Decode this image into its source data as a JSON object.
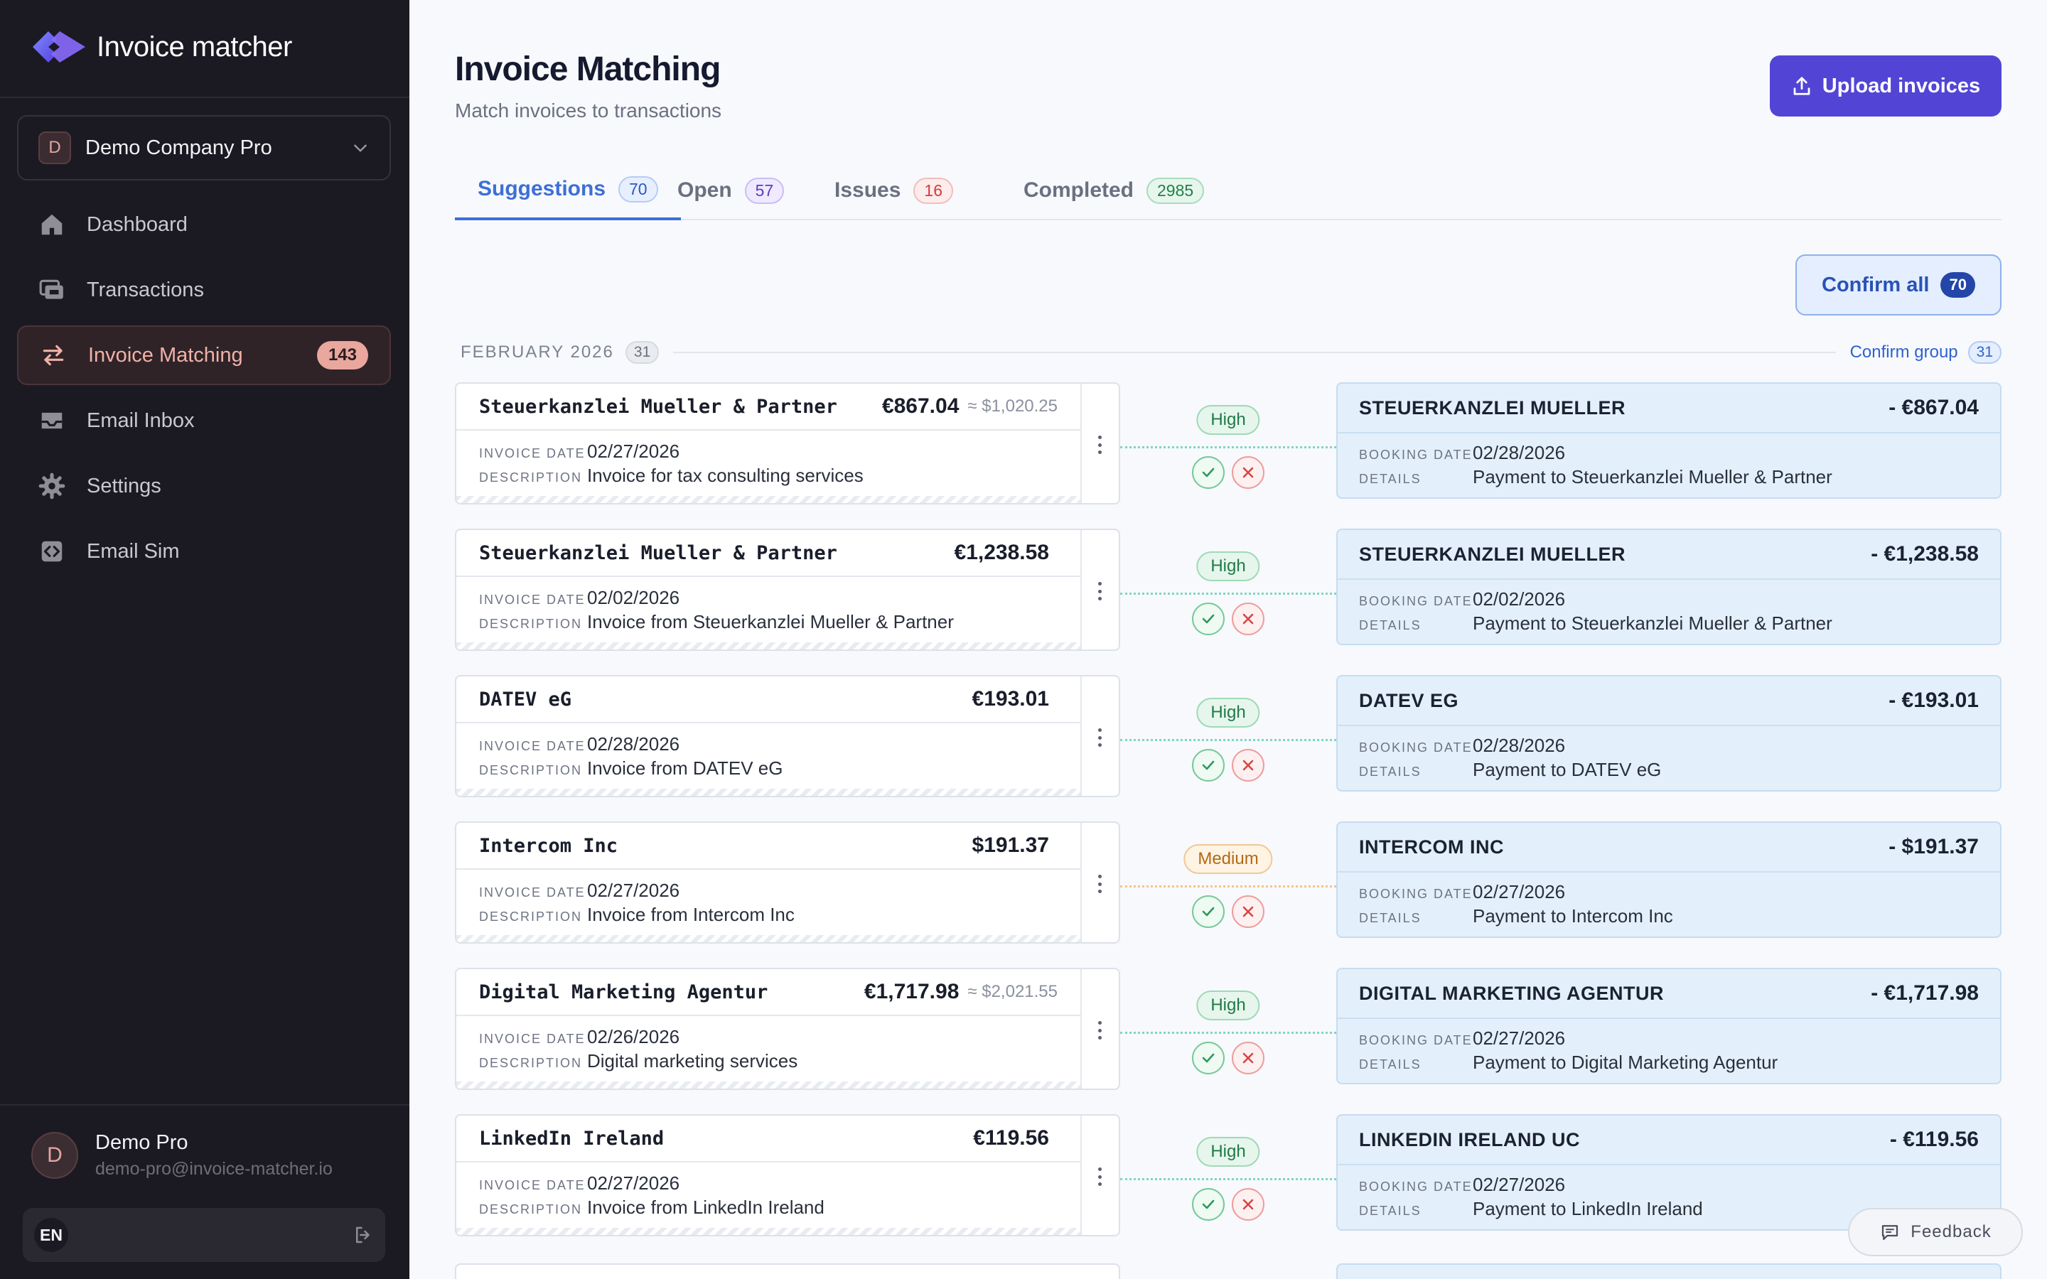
{
  "app": {
    "name": "Invoice matcher"
  },
  "company": {
    "initial": "D",
    "name": "Demo Company Pro"
  },
  "nav": [
    {
      "label": "Dashboard",
      "icon": "home-icon",
      "badge": ""
    },
    {
      "label": "Transactions",
      "icon": "transactions-icon",
      "badge": ""
    },
    {
      "label": "Invoice Matching",
      "icon": "swap-arrows-icon",
      "badge": "143"
    },
    {
      "label": "Email Inbox",
      "icon": "inbox-icon",
      "badge": ""
    },
    {
      "label": "Settings",
      "icon": "gear-icon",
      "badge": ""
    },
    {
      "label": "Email Sim",
      "icon": "code-icon",
      "badge": ""
    }
  ],
  "user": {
    "initial": "D",
    "name": "Demo Pro",
    "email": "demo-pro@invoice-matcher.io",
    "lang": "EN"
  },
  "header": {
    "title": "Invoice Matching",
    "subtitle": "Match invoices to transactions",
    "upload_label": "Upload invoices"
  },
  "tabs": [
    {
      "label": "Suggestions",
      "count": "70"
    },
    {
      "label": "Open",
      "count": "57"
    },
    {
      "label": "Issues",
      "count": "16"
    },
    {
      "label": "Completed",
      "count": "2985"
    }
  ],
  "confirm_all": {
    "label": "Confirm all",
    "count": "70"
  },
  "group": {
    "label": "FEBRUARY 2026",
    "count": "31",
    "confirm_label": "Confirm group",
    "confirm_count": "31"
  },
  "labels": {
    "invoice_date": "INVOICE DATE",
    "description": "DESCRIPTION",
    "booking_date": "BOOKING DATE",
    "details": "DETAILS"
  },
  "rows": [
    {
      "vendor": "Steuerkanzlei Mueller & Partner",
      "amount": "€867.04",
      "converted": "≈ $1,020.25",
      "invoice_date": "02/27/2026",
      "description": "Invoice for tax consulting services",
      "confidence": "High",
      "txn_name": "STEUERKANZLEI MUELLER",
      "txn_amount": "- €867.04",
      "booking_date": "02/28/2026",
      "details": "Payment to Steuerkanzlei Mueller & Partner"
    },
    {
      "vendor": "Steuerkanzlei Mueller & Partner",
      "amount": "€1,238.58",
      "converted": "",
      "invoice_date": "02/02/2026",
      "description": "Invoice from Steuerkanzlei Mueller & Partner",
      "confidence": "High",
      "txn_name": "STEUERKANZLEI MUELLER",
      "txn_amount": "- €1,238.58",
      "booking_date": "02/02/2026",
      "details": "Payment to Steuerkanzlei Mueller & Partner"
    },
    {
      "vendor": "DATEV eG",
      "amount": "€193.01",
      "converted": "",
      "invoice_date": "02/28/2026",
      "description": "Invoice from DATEV eG",
      "confidence": "High",
      "txn_name": "DATEV EG",
      "txn_amount": "- €193.01",
      "booking_date": "02/28/2026",
      "details": "Payment to DATEV eG"
    },
    {
      "vendor": "Intercom Inc",
      "amount": "$191.37",
      "converted": "",
      "invoice_date": "02/27/2026",
      "description": "Invoice from Intercom Inc",
      "confidence": "Medium",
      "txn_name": "INTERCOM INC",
      "txn_amount": "- $191.37",
      "booking_date": "02/27/2026",
      "details": "Payment to Intercom Inc"
    },
    {
      "vendor": "Digital Marketing Agentur",
      "amount": "€1,717.98",
      "converted": "≈ $2,021.55",
      "invoice_date": "02/26/2026",
      "description": "Digital marketing services",
      "confidence": "High",
      "txn_name": "DIGITAL MARKETING AGENTUR",
      "txn_amount": "- €1,717.98",
      "booking_date": "02/27/2026",
      "details": "Payment to Digital Marketing Agentur"
    },
    {
      "vendor": "LinkedIn Ireland",
      "amount": "€119.56",
      "converted": "",
      "invoice_date": "02/27/2026",
      "description": "Invoice from LinkedIn Ireland",
      "confidence": "High",
      "txn_name": "LINKEDIN IRELAND UC",
      "txn_amount": "- €119.56",
      "booking_date": "02/27/2026",
      "details": "Payment to LinkedIn Ireland"
    }
  ],
  "feedback": {
    "label": "Feedback"
  },
  "colors": {
    "sidebar_bg": "#1b1a22",
    "primary": "#5245d6",
    "accent_active": "#efb2a7",
    "tab_active": "#3d6fd6",
    "high": "#1f7a48",
    "medium": "#b06a15"
  }
}
